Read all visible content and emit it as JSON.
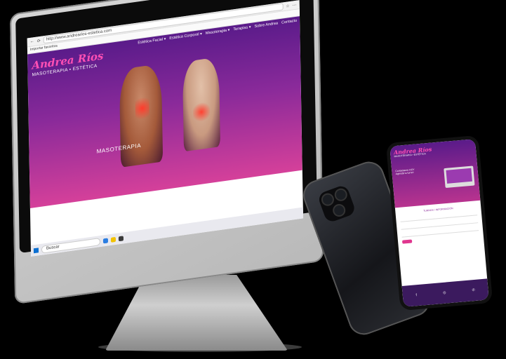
{
  "browser": {
    "url": "http://www.andrearios-estetica.com",
    "bookmarks_label": "Importar favoritos"
  },
  "site": {
    "logo": "Andrea Ríos",
    "tagline": "MASOTERAPIA • ESTÉTICA",
    "nav": [
      "Estética Facial ▾",
      "Estética Corporal ▾",
      "Masoterapia ▾",
      "Terapias ▾",
      "Sobre Andrea",
      "Contacto"
    ],
    "hero_label": "MASOTERAPIA"
  },
  "taskbar": {
    "search_placeholder": "Buscar"
  },
  "phone": {
    "logo": "Andrea Ríos",
    "tagline": "MASOTERAPIA • ESTÉTICA",
    "hero_text": "Contactame HOY Agendá tu turno!",
    "section_title": "TURNOS / INFORMACIÓN"
  },
  "colors": {
    "brand_pink": "#ff4fb4",
    "brand_purple": "#5a1b8a"
  }
}
